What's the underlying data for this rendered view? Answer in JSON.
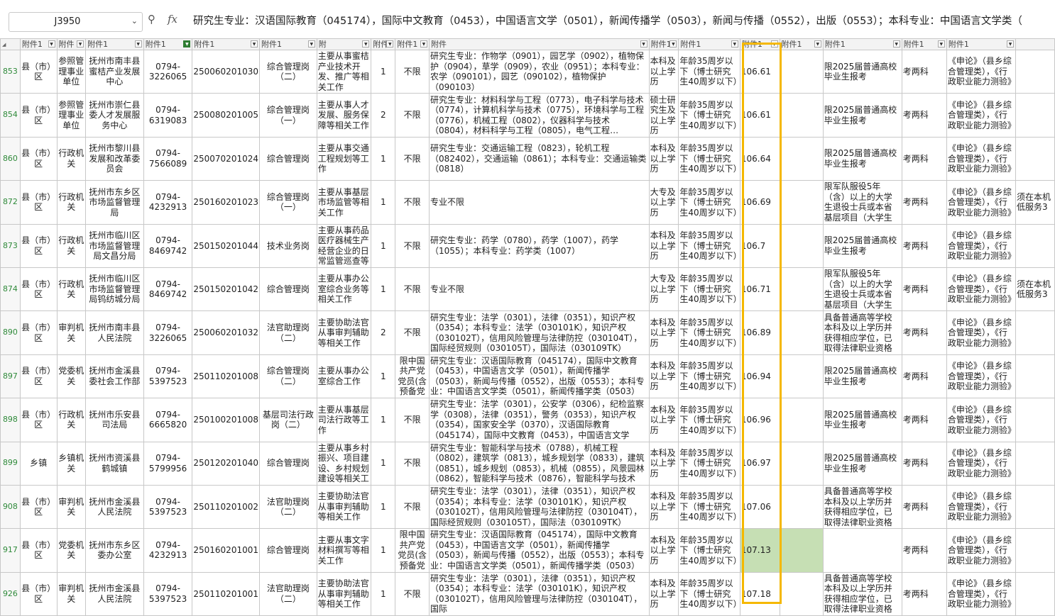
{
  "formula_bar": {
    "name_box": "J3950",
    "formula": "研究生专业：汉语国际教育（045174），国际中文教育（0453），中国语言文学（0501），新闻传播学（0503），新闻与传播（0552），出版（0553）；本科专业：中国语言文学类（"
  },
  "header_labels": [
    "附件1",
    "附件",
    "附件1",
    "附件1",
    "附件1",
    "附件1",
    "附",
    "附件1",
    "附件1",
    "附件",
    "附件1",
    "附件1",
    "附件1",
    "附件1",
    "附件1",
    "附件1",
    "附件1"
  ],
  "rows": [
    {
      "rn": "853",
      "c": [
        "县（市）区",
        "参照管理事业单位",
        "抚州市南丰县蜜桔产业发展中心",
        "0794-3226065",
        "250060201030",
        "综合管理岗（二）",
        "主要从事蜜桔产业技术开发、推广等相关工作",
        "1",
        "不限",
        "研究生专业：作物学（0901），园艺学（0902），植物保护（0904），草学（0909），农业（0951）；本科专业：农学（090101），园艺（090102），植物保护（090103）",
        "本科及以上学历",
        "年龄35周岁以下（博士研究生40周岁以下）",
        "106.61",
        "",
        "限2025届普通高校毕业生报考",
        "考两科",
        "《申论》（县乡综合管理类），《行政职业能力测验》",
        ""
      ]
    },
    {
      "rn": "854",
      "c": [
        "县（市）区",
        "参照管理事业单位",
        "抚州市崇仁县委人才发展服务中心",
        "0794-6319083",
        "250080201005",
        "综合管理岗（一）",
        "主要从事人才发展、服务保障等相关工作",
        "2",
        "不限",
        "研究生专业：材料科学与工程（0773），电子科学与技术（0774），计算机科学与技术（0775），环境科学与工程（0776），机械工程（0802），仪器科学与技术（0804），材料科学与工程（0805），电气工程（0808），电子科学与",
        "硕士研究生及以上学历",
        "年龄35周岁以下（博士研究生40周岁以下）",
        "106.61",
        "",
        "限2025届普通高校毕业生报考",
        "考两科",
        "《申论》（县乡综合管理类），《行政职业能力测验》",
        ""
      ]
    },
    {
      "rn": "860",
      "c": [
        "县（市）区",
        "行政机关",
        "抚州市黎川县发展和改革委员会",
        "0794-7566089",
        "250070201024",
        "综合管理岗",
        "主要从事交通工程规划等工作",
        "1",
        "不限",
        "研究生专业：交通运输工程（0823），轮机工程（082402），交通运输（0861）；本科专业：交通运输类（0818）",
        "本科及以上学历",
        "年龄35周岁以下（博士研究生40周岁以下）",
        "106.64",
        "",
        "限2025届普通高校毕业生报考",
        "考两科",
        "《申论》（县乡综合管理类），《行政职业能力测验》",
        ""
      ]
    },
    {
      "rn": "872",
      "c": [
        "县（市）区",
        "行政机关",
        "抚州市东乡区市场监督管理局",
        "0794-4232913",
        "250160201023",
        "综合管理岗（一）",
        "主要从事基层市场监管等相关工作",
        "1",
        "不限",
        "专业不限",
        "大专及以上学历",
        "年龄35周岁以下（博士研究生40周岁以下）",
        "106.69",
        "",
        "限军队服役5年（含）以上的大学生退役士兵或本省基层项目（大学生",
        "考两科",
        "《申论》（县乡综合管理类），《行政职业能力测验》",
        "须在本机低服务3"
      ]
    },
    {
      "rn": "873",
      "c": [
        "县（市）区",
        "行政机关",
        "抚州市临川区市场监督管理局文昌分局",
        "0794-8469742",
        "250150201044",
        "技术业务岗",
        "主要从事药品医疗器械生产经营企业的日常监管巡查等",
        "1",
        "不限",
        "研究生专业：药学（0780），药学（1007），药学（1055）；本科专业：药学类（1007）",
        "本科及以上学历",
        "年龄35周岁以下（博士研究生40周岁以下）",
        "106.7",
        "",
        "限2025届普通高校毕业生报考",
        "考两科",
        "《申论》（县乡综合管理类），《行政职业能力测验》",
        ""
      ]
    },
    {
      "rn": "874",
      "c": [
        "县（市）区",
        "行政机关",
        "抚州市临川区市场监督管理局钨纺城分局",
        "0794-8469742",
        "250150201042",
        "综合管理岗",
        "主要从事办公室综合业务等相关工作",
        "1",
        "不限",
        "专业不限",
        "大专及以上学历",
        "年龄35周岁以下（博士研究生40周岁以下）",
        "106.71",
        "",
        "限军队服役5年（含）以上的大学生退役士兵或本省基层项目（大学生",
        "考两科",
        "《申论》（县乡综合管理类），《行政职业能力测验》",
        "须在本机低服务3"
      ]
    },
    {
      "rn": "890",
      "c": [
        "县（市）区",
        "审判机关",
        "抚州市南丰县人民法院",
        "0794-3226065",
        "250060201032",
        "法官助理岗（二）",
        "主要协助法官从事审判辅助等相关工作",
        "2",
        "不限",
        "研究生专业：法学（0301），法律（0351），知识产权（0354）；本科专业：法学（030101K），知识产权（030102T），信用风险管理与法律防控（030104T），国际经贸规则（030105T），国际法（030109TK）",
        "本科及以上学历",
        "年龄35周岁以下（博士研究生40周岁以下）",
        "106.89",
        "",
        "具备普通高等学校本科及以上学历并获得相应学位，已取得法律职业资格",
        "考两科",
        "《申论》（县乡综合管理类），《行政职业能力测验》",
        ""
      ]
    },
    {
      "rn": "897",
      "c": [
        "县（市）区",
        "党委机关",
        "抚州市金溪县委社会工作部",
        "0794-5397523",
        "250110201008",
        "综合管理岗（二）",
        "主要从事办公室综合工作",
        "1",
        "限中国共产党党员(含预备党",
        "研究生专业：汉语国际教育（045174），国际中文教育（0453），中国语言文学（0501），新闻传播学（0503），新闻与传播（0552），出版（0553）；本科专业：中国语言文学类（0501），新闻传播学类（0503）",
        "本科及以上学历",
        "年龄35周岁以下（博士研究生40周岁以下）",
        "106.94",
        "",
        "限2025届普通高校毕业生报考",
        "考两科",
        "《申论》（县乡综合管理类），《行政职业能力测验》",
        ""
      ]
    },
    {
      "rn": "898",
      "c": [
        "县（市）区",
        "行政机关",
        "抚州市乐安县司法局",
        "0794-6665820",
        "250100201008",
        "基层司法行政岗（二）",
        "主要从事基层司法行政等工作",
        "1",
        "不限",
        "研究生专业：法学（0301），公安学（0306），纪检监察学（0308），法律（0351），警务（0353），知识产权（0354），国家安全学（0370），汉语国际教育（045174），国际中文教育（0453），中国语言文学",
        "本科及以上学历",
        "年龄35周岁以下（博士研究生40周岁以下）",
        "106.96",
        "",
        "限2025届普通高校毕业生报考",
        "考两科",
        "《申论》（县乡综合管理类），《行政职业能力测验》",
        ""
      ]
    },
    {
      "rn": "899",
      "c": [
        "乡镇",
        "乡镇机关",
        "抚州市资溪县鹤城镇",
        "0794-5799956",
        "250120201040",
        "综合管理岗",
        "主要从事乡村振兴、项目建设、乡村规划建设等相关工",
        "1",
        "不限",
        "研究生专业：智能科学与技术（0788），机械工程（0802），建筑学（0813），城乡规划学（0833），建筑（0851），城乡规划（0853），机械（0855），风景园林（0862），智能科学与技术（0876），智能科学与技术",
        "本科及以上学历",
        "年龄35周岁以下（博士研究生40周岁以下）",
        "106.97",
        "",
        "限2025届普通高校毕业生报考",
        "考两科",
        "《申论》（县乡综合管理类），《行政职业能力测验》",
        ""
      ]
    },
    {
      "rn": "908",
      "c": [
        "县（市）区",
        "审判机关",
        "抚州市金溪县人民法院",
        "0794-5397523",
        "250110201002",
        "法官助理岗（二）",
        "主要协助法官从事审判辅助等相关工作",
        "1",
        "不限",
        "研究生专业：法学（0301），法律（0351），知识产权（0354）；本科专业：法学（030101K），知识产权（030102T），信用风险管理与法律防控（030104T），国际经贸规则（030105T），国际法（030109TK）",
        "本科及以上学历",
        "年龄35周岁以下（博士研究生40周岁以下）",
        "107.06",
        "",
        "具备普通高等学校本科及以上学历并获得相应学位，已取得法律职业资格",
        "考两科",
        "《申论》（县乡综合管理类），《行政职业能力测验》",
        ""
      ]
    },
    {
      "rn": "917",
      "c": [
        "县（市）区",
        "党委机关",
        "抚州市东乡区委办公室",
        "0794-4232913",
        "250160201001",
        "综合管理岗",
        "主要从事文字材料撰写等相关工作",
        "1",
        "限中国共产党党员(含预备党",
        "研究生专业：汉语国际教育（045174），国际中文教育（0453），中国语言文学（0501），新闻传播学（0503），新闻与传播（0552），出版（0553）；本科专业：中国语言文学类（0501），新闻传播学类（0503）",
        "本科及以上学历",
        "年龄35周岁以下（博士研究生40周岁以下）",
        "107.13",
        "",
        "",
        "考两科",
        "《申论》（县乡综合管理类），《行政职业能力测验》",
        ""
      ]
    },
    {
      "rn": "926",
      "c": [
        "县（市）区",
        "审判机关",
        "抚州市金溪县人民法院",
        "0794-5397523",
        "250110201001",
        "法官助理岗（二）",
        "主要协助法官从事审判辅助等相关工作",
        "1",
        "不限",
        "研究生专业：法学（0301），法律（0351），知识产权（0354）；本科专业：法学（030101K），知识产权（030102T），信用风险管理与法律防控（030104T），国际",
        "本科及以上学历",
        "年龄35周岁以下（博士研究生40周岁以下）",
        "107.18",
        "",
        "具备普通高等学校本科及以上学历并获得相应学位，已取得法律职业资格",
        "考两科",
        "《申论》（县乡综合管理类），《行政职业能力测验》",
        ""
      ]
    }
  ],
  "colors": {
    "highlight_border": "#f5b800",
    "selected_fill": "#c6dfb4",
    "row_number": "#2f8a3a"
  }
}
